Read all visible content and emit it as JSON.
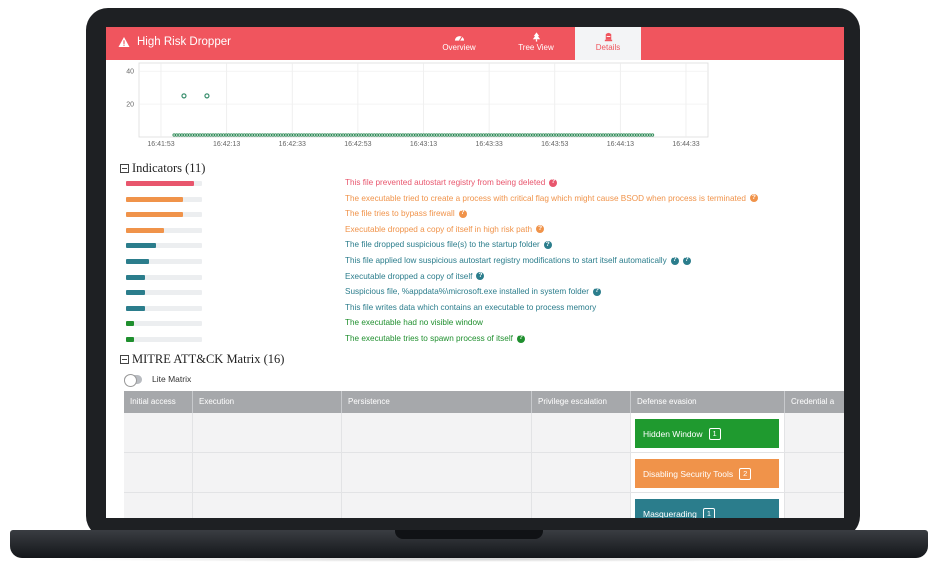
{
  "header": {
    "title": "High Risk Dropper",
    "tabs": [
      {
        "label": "Overview",
        "icon": "dashboard-icon",
        "active": false
      },
      {
        "label": "Tree View",
        "icon": "tree-icon",
        "active": false
      },
      {
        "label": "Details",
        "icon": "details-icon",
        "active": true
      }
    ],
    "colors": {
      "bar": "#f0555e",
      "active_tab_bg": "#f3f4f6"
    }
  },
  "chart_data": {
    "type": "scatter",
    "x_tick_labels": [
      "16:41:53",
      "16:42:13",
      "16:42:33",
      "16:42:53",
      "16:43:13",
      "16:43:33",
      "16:43:53",
      "16:44:13",
      "16:44:33"
    ],
    "y_ticks": [
      20,
      40
    ],
    "ylim": [
      0,
      45
    ],
    "series": [
      {
        "color": "#3a8f6e",
        "points": [
          {
            "x": "16:42:00",
            "y": 25
          },
          {
            "x": "16:42:07",
            "y": 25
          }
        ]
      },
      {
        "color": "#2e8b57",
        "dense_baseline": {
          "from": "16:41:57",
          "to": "16:44:23",
          "y": 0
        }
      }
    ]
  },
  "indicators": {
    "title": "Indicators (11)",
    "items": [
      {
        "text": "This file prevented autostart registry from being deleted",
        "level": 0.9,
        "color": "#e8566d",
        "icons": 1
      },
      {
        "text": "The executable tried to create a process with critical flag which might cause BSOD when process is terminated",
        "level": 0.75,
        "color": "#f0934a",
        "icons": 1
      },
      {
        "text": "The file tries to bypass firewall",
        "level": 0.75,
        "color": "#f0934a",
        "icons": 1
      },
      {
        "text": "Executable dropped a copy of itself in high risk path",
        "level": 0.5,
        "color": "#f0934a",
        "icons": 1
      },
      {
        "text": "The file dropped suspicious file(s) to the startup folder",
        "level": 0.4,
        "color": "#2b7d8c",
        "icons": 1
      },
      {
        "text": "This file applied low suspicious autostart registry modifications to start itself automatically",
        "level": 0.3,
        "color": "#2b7d8c",
        "icons": 2
      },
      {
        "text": "Executable dropped a copy of itself",
        "level": 0.25,
        "color": "#2b7d8c",
        "icons": 1
      },
      {
        "text": "Suspicious file, %appdata%\\microsoft.exe installed in system folder",
        "level": 0.25,
        "color": "#2b7d8c",
        "icons": 1
      },
      {
        "text": "This file writes data which contains an executable to process memory",
        "level": 0.25,
        "color": "#2b7d8c",
        "icons": 0
      },
      {
        "text": "The executable had no visible window",
        "level": 0.1,
        "color": "#1f8f2e",
        "icons": 0
      },
      {
        "text": "The executable tries to spawn process of itself",
        "level": 0.1,
        "color": "#1f8f2e",
        "icons": 1
      }
    ]
  },
  "mitre": {
    "title": "MITRE ATT&CK Matrix (16)",
    "toggle_label": "Lite Matrix",
    "columns": [
      "Initial access",
      "Execution",
      "Persistence",
      "Privilege escalation",
      "Defense evasion",
      "Credential a"
    ],
    "techniques": [
      {
        "label": "Hidden Window",
        "count": "1",
        "color": "#1f9a2f"
      },
      {
        "label": "Disabling Security Tools",
        "count": "2",
        "color": "#f0934a"
      },
      {
        "label": "Masquerading",
        "count": "1",
        "color": "#2b7d8c"
      }
    ]
  }
}
